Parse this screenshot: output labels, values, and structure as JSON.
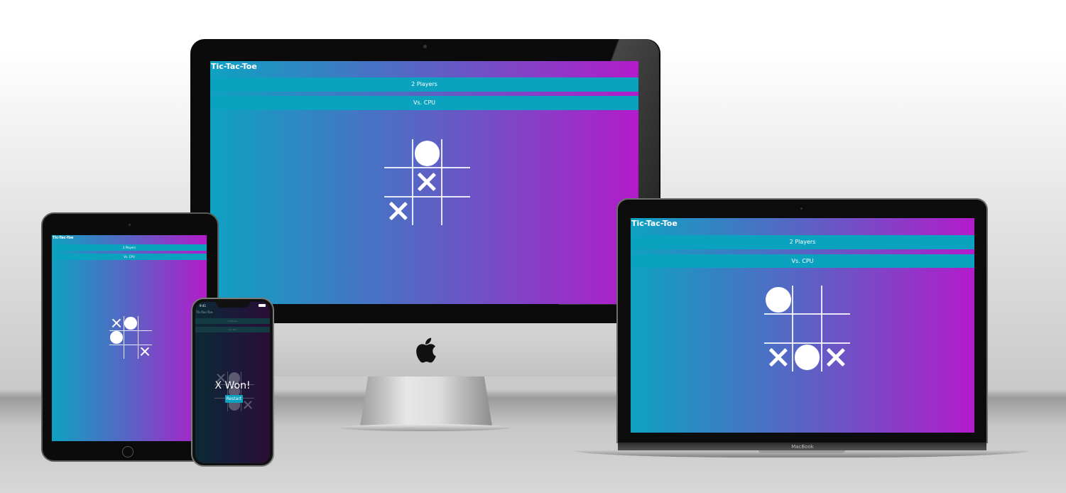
{
  "app": {
    "title": "Tic-Tac-Toe",
    "button_two_players": "2 Players",
    "button_vs_cpu": "Vs. CPU"
  },
  "devices": {
    "laptop_label": "MacBook",
    "phone_status_time": "9:41"
  },
  "imac_board": [
    "",
    "O",
    "",
    "",
    "X",
    "",
    "X",
    "",
    ""
  ],
  "laptop_board": [
    "O",
    "",
    "",
    "",
    "",
    "",
    "X",
    "O",
    "X"
  ],
  "tablet_board": [
    "X",
    "O",
    "",
    "O",
    "",
    "",
    "",
    "",
    "X"
  ],
  "phone_result": {
    "message": "X Won!",
    "restart_label": "Restart"
  },
  "colors": {
    "gradient_start": "#0ea2c2",
    "gradient_end": "#b31bca",
    "button": "#0aa2be"
  }
}
